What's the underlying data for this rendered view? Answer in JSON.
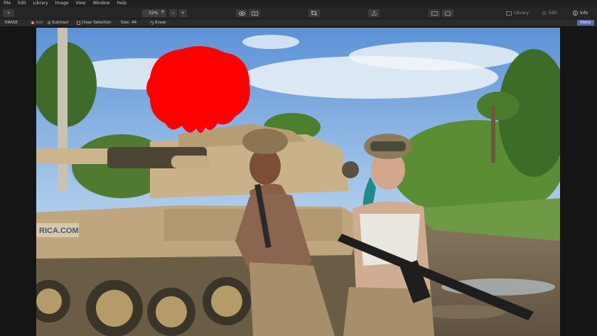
{
  "menu": {
    "items": [
      "File",
      "Edit",
      "Library",
      "Image",
      "View",
      "Window",
      "Help"
    ]
  },
  "toolbar": {
    "zoom_value": "32%",
    "zoom_out_label": "−",
    "zoom_in_label": "+",
    "library_label": "Library",
    "edit_label": "Edit",
    "info_label": "Info"
  },
  "options": {
    "mode_label": "ERASE",
    "add_label": "Add",
    "subtract_label": "Subtract",
    "clear_label": "Clear Selection",
    "size_label": "Size:",
    "size_value": "44",
    "erase_label": "Erase",
    "done_label": "Done"
  },
  "tank_marking": "RICA.COM",
  "colors": {
    "accent": "#5a6fa8",
    "mask": "#ff0000",
    "add_dot": "#e89a3a",
    "subtract_dot": "#9a9a9a"
  }
}
